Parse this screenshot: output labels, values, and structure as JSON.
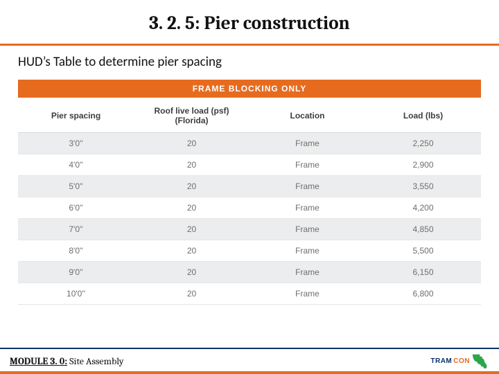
{
  "title": "3. 2. 5: Pier construction",
  "subtitle": "HUD’s Table to determine pier spacing",
  "table": {
    "banner": "FRAME BLOCKING ONLY",
    "headers": [
      "Pier spacing",
      "Roof live load (psf) (Florida)",
      "Location",
      "Load (lbs)"
    ],
    "rows": [
      [
        "3'0''",
        "20",
        "Frame",
        "2,250"
      ],
      [
        "4'0''",
        "20",
        "Frame",
        "2,900"
      ],
      [
        "5'0''",
        "20",
        "Frame",
        "3,550"
      ],
      [
        "6'0''",
        "20",
        "Frame",
        "4,200"
      ],
      [
        "7'0''",
        "20",
        "Frame",
        "4,850"
      ],
      [
        "8'0''",
        "20",
        "Frame",
        "5,500"
      ],
      [
        "9'0''",
        "20",
        "Frame",
        "6,150"
      ],
      [
        "10'0''",
        "20",
        "Frame",
        "6,800"
      ]
    ]
  },
  "footer": {
    "module_prefix": "MODULE 3. 0:",
    "module_suffix": " Site Assembly",
    "logo_a": "TRAM",
    "logo_b": "CON"
  }
}
